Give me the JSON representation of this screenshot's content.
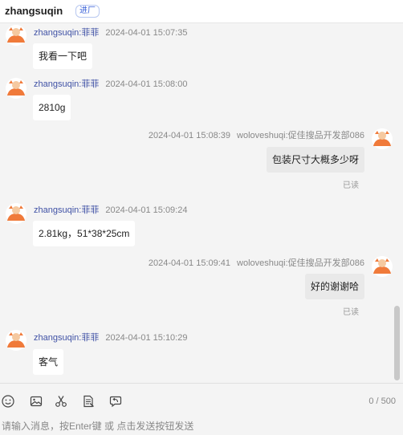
{
  "header": {
    "contact_name": "zhangsuqin",
    "badge": "进厂"
  },
  "messages": [
    {
      "side": "left",
      "user": "zhangsuqin:菲菲",
      "time": "2024-04-01 15:07:35",
      "text": "我看一下吧"
    },
    {
      "side": "left",
      "user": "zhangsuqin:菲菲",
      "time": "2024-04-01 15:08:00",
      "text": "2810g"
    },
    {
      "side": "right",
      "time": "2024-04-01 15:08:39",
      "sender": "woloveshuqi:促佳搜品开发部086",
      "text": "包装尺寸大概多少呀",
      "status": "已读"
    },
    {
      "side": "left",
      "user": "zhangsuqin:菲菲",
      "time": "2024-04-01 15:09:24",
      "text": "2.81kg，51*38*25cm"
    },
    {
      "side": "right",
      "time": "2024-04-01 15:09:41",
      "sender": "woloveshuqi:促佳搜品开发部086",
      "text": "好的谢谢哈",
      "status": "已读"
    },
    {
      "side": "left",
      "user": "zhangsuqin:菲菲",
      "time": "2024-04-01 15:10:29",
      "text": "客气"
    }
  ],
  "toolbar": {
    "icons": [
      "emoji-icon",
      "image-icon",
      "scissors-icon",
      "document-icon",
      "recall-icon"
    ],
    "counter": "0 / 500"
  },
  "input": {
    "placeholder": "请输入消息，按Enter键 或 点击发送按钮发送",
    "value": ""
  },
  "colors": {
    "username": "#3f51a5",
    "avatar": "#f07a3a",
    "badge_text": "#3a62d8"
  }
}
